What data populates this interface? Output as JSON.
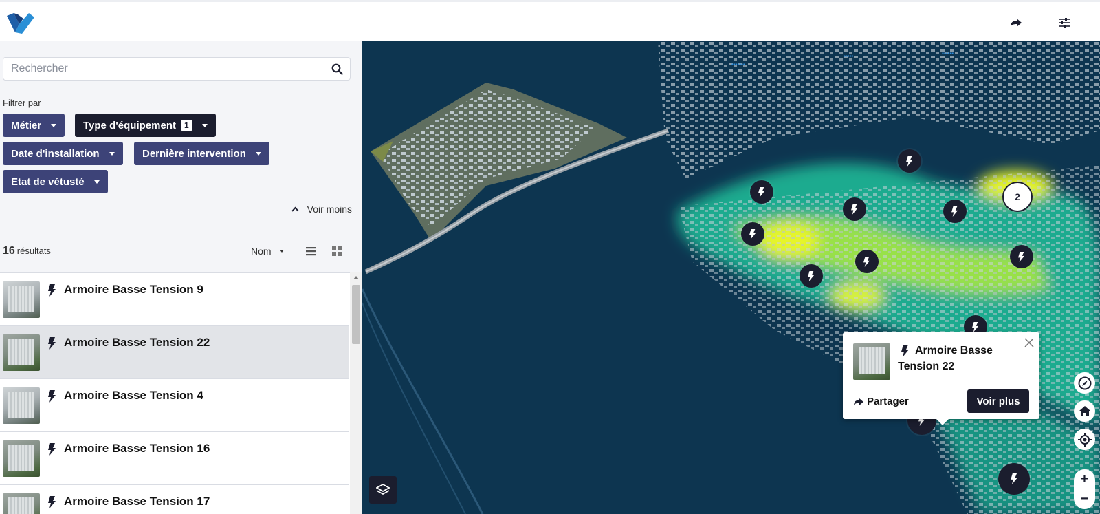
{
  "header": {
    "logo_icon": "app-logo",
    "share_icon": "share-arrow-icon",
    "settings_icon": "sliders-icon"
  },
  "sidebar": {
    "search": {
      "placeholder": "Rechercher",
      "value": ""
    },
    "filter_title": "Filtrer par",
    "filters": [
      {
        "label": "Métier",
        "active": false
      },
      {
        "label": "Type d'équipement",
        "active": true,
        "count": "1"
      },
      {
        "label": "Date d'installation",
        "active": false
      },
      {
        "label": "Dernière intervention",
        "active": false
      },
      {
        "label": "Etat de vétusté",
        "active": false
      }
    ],
    "toggle_label": "Voir moins",
    "results_count": "16",
    "results_label": "résultats",
    "sort_label": "Nom",
    "items": [
      {
        "title": "Armoire Basse Tension 9",
        "selected": false
      },
      {
        "title": "Armoire Basse Tension 22",
        "selected": true
      },
      {
        "title": "Armoire Basse Tension 4",
        "selected": false
      },
      {
        "title": "Armoire Basse Tension 16",
        "selected": false
      },
      {
        "title": "Armoire Basse Tension 17",
        "selected": false
      }
    ]
  },
  "map": {
    "cluster_count": "2",
    "colors": {
      "water": "#0d3550",
      "marker": "#1b1d2e",
      "heat_low": "#1fd3a4",
      "heat_high": "#e6f52c"
    }
  },
  "popup": {
    "title": "Armoire Basse Tension 22",
    "share_label": "Partager",
    "more_label": "Voir plus"
  }
}
